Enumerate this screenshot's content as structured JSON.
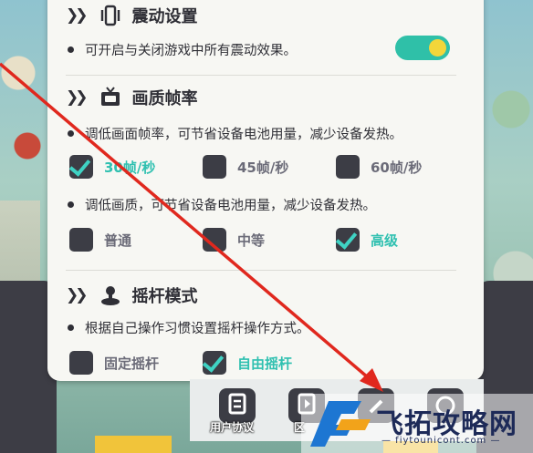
{
  "vibration": {
    "title": "震动设置",
    "desc": "可开启与关闭游戏中所有震动效果。",
    "toggle_on": true
  },
  "quality": {
    "title": "画质帧率",
    "fps_desc": "调低画面帧率，可节省设备电池用量，减少设备发热。",
    "fps_options": [
      {
        "label": "30帧/秒",
        "checked": true
      },
      {
        "label": "45帧/秒",
        "checked": false
      },
      {
        "label": "60帧/秒",
        "checked": false
      }
    ],
    "quality_desc": "调低画质，可节省设备电池用量，减少设备发热。",
    "quality_options": [
      {
        "label": "普通",
        "checked": false
      },
      {
        "label": "中等",
        "checked": false
      },
      {
        "label": "高级",
        "checked": true
      }
    ]
  },
  "joystick": {
    "title": "摇杆模式",
    "desc": "根据自己操作习惯设置摇杆操作方式。",
    "options": [
      {
        "label": "固定摇杆",
        "checked": false
      },
      {
        "label": "自由摇杆",
        "checked": true
      }
    ]
  },
  "bottom": {
    "user_agreement": "用户协议",
    "partial_label": "区"
  },
  "watermark": {
    "text": "飞拓攻略网",
    "sub": "— fiytounicont.com —"
  },
  "colors": {
    "accent": "#2fc0b0",
    "arrow": "#e0281e",
    "knob": "#f3d63a"
  }
}
